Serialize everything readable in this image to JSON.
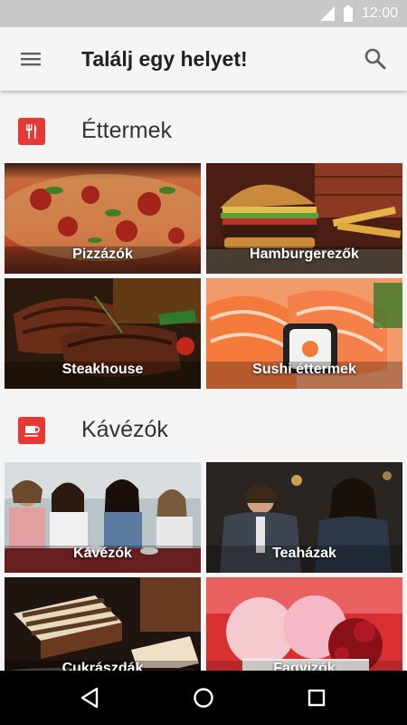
{
  "status_bar": {
    "time": "12:00"
  },
  "app_bar": {
    "title": "Találj egy helyet!"
  },
  "sections": [
    {
      "title": "Éttermek",
      "tiles": [
        {
          "label": "Pizzázók"
        },
        {
          "label": "Hamburgerezők"
        },
        {
          "label": "Steakhouse"
        },
        {
          "label": "Sushi éttermek"
        }
      ]
    },
    {
      "title": "Kávézók",
      "tiles": [
        {
          "label": "Kávézók"
        },
        {
          "label": "Teaházak"
        },
        {
          "label": "Cukrászdák"
        },
        {
          "label": "Fagyizók"
        }
      ]
    }
  ],
  "colors": {
    "accent": "#e53935",
    "status_bar": "#c8c8c8",
    "nav_bar": "#000000"
  }
}
